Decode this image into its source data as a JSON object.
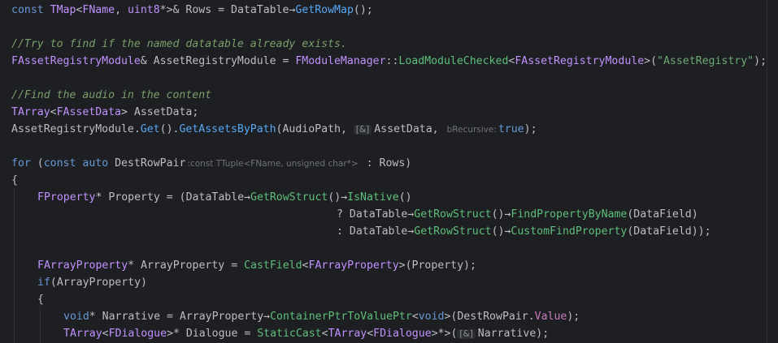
{
  "editor": {
    "lines": {
      "l1": {
        "kw1": "const",
        "t1": "TMap",
        "lt": "<",
        "t2": "FName",
        "comma": ", ",
        "t3": "uint8",
        "rest1": "*>& Rows = DataTable",
        "arrow": "→",
        "fn": "GetRowMap",
        "end": "();"
      },
      "l3": {
        "comment": "//Try to find if the named datatable already exists."
      },
      "l4": {
        "t1": "FAssetRegistryModule",
        "mid": "& AssetRegistryModule = ",
        "t2": "FModuleManager",
        "sep": "::",
        "fn": "LoadModuleChecked",
        "lt": "<",
        "t3": "FAssetRegistryModule",
        "gt": ">(",
        "str": "\"AssetRegistry\"",
        "end": ");"
      },
      "l6": {
        "comment": "//Find the audio in the content"
      },
      "l7": {
        "t1": "TArray",
        "lt": "<",
        "t2": "FAssetData",
        "rest": "> AssetData;"
      },
      "l8": {
        "a": "AssetRegistryModule.",
        "fn1": "Get",
        "b": "().",
        "fn2": "GetAssetsByPath",
        "c": "(AudioPath, ",
        "hint1": "[&]",
        "d": "AssetData, ",
        "hint2": "bRecursive:",
        "kw": "true",
        "end": ");"
      },
      "l10": {
        "kw1": "for",
        "a": " (",
        "kw2": "const",
        "sp": " ",
        "kw3": "auto",
        "b": " DestRowPair",
        "hint": ":const TTuple<FName, unsigned char*>",
        "c": " : Rows)"
      },
      "l11": {
        "brace": "{"
      },
      "l12": {
        "t1": "FProperty",
        "a": "* Property = (DataTable",
        "arrow1": "→",
        "fn1": "GetRowStruct",
        "b": "()",
        "arrow2": "→",
        "fn2": "IsNative",
        "c": "()"
      },
      "l13": {
        "a": "? DataTable",
        "arrow1": "→",
        "fn1": "GetRowStruct",
        "b": "()",
        "arrow2": "→",
        "fn2": "FindPropertyByName",
        "c": "(DataField)"
      },
      "l14": {
        "a": ": DataTable",
        "arrow1": "→",
        "fn1": "GetRowStruct",
        "b": "()",
        "arrow2": "→",
        "fn2": "CustomFindProperty",
        "c": "(DataField));"
      },
      "l16": {
        "t1": "FArrayProperty",
        "a": "* ArrayProperty = ",
        "fn": "CastField",
        "lt": "<",
        "t2": "FArrayProperty",
        "b": ">(Property);"
      },
      "l17": {
        "kw": "if",
        "rest": "(ArrayProperty)"
      },
      "l18": {
        "brace": "{"
      },
      "l19": {
        "kw1": "void",
        "a": "* Narrative = ArrayProperty",
        "arrow": "→",
        "fn": "ContainerPtrToValuePtr",
        "lt": "<",
        "kw2": "void",
        "b": ">(DestRowPair.",
        "field": "Value",
        "end": ");"
      },
      "l20": {
        "t1": "TArray",
        "lt": "<",
        "t2": "FDialogue",
        "a": ">* Dialogue = ",
        "fn": "StaticCast",
        "lt2": "<",
        "t3": "TArray",
        "lt3": "<",
        "t4": "FDialogue",
        "b": ">*>(",
        "hint": "[&]",
        "c": "Narrative);"
      }
    }
  }
}
